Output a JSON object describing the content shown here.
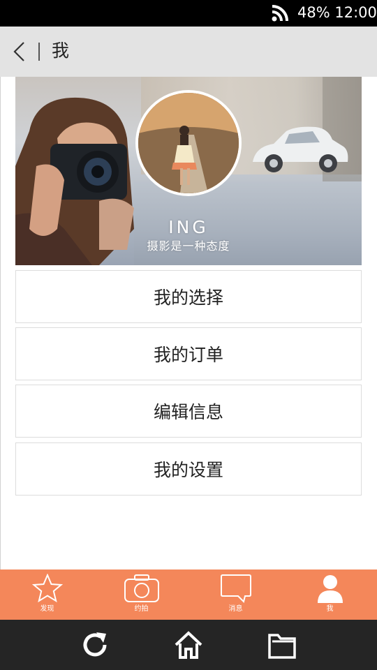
{
  "status_bar": {
    "battery_time": "48% 12:00",
    "icons": [
      "wifi-signal-icon"
    ]
  },
  "nav": {
    "back_icon": "chevron-left-icon",
    "title": "我"
  },
  "profile": {
    "name": "ING",
    "tagline": "摄影是一种态度"
  },
  "menu": [
    {
      "label": "我的选择"
    },
    {
      "label": "我的订单"
    },
    {
      "label": "编辑信息"
    },
    {
      "label": "我的设置"
    }
  ],
  "tabs": [
    {
      "label": "发现",
      "icon": "star-icon"
    },
    {
      "label": "约拍",
      "icon": "camera-icon"
    },
    {
      "label": "消息",
      "icon": "message-icon"
    },
    {
      "label": "我",
      "icon": "person-icon"
    }
  ],
  "system_nav": {
    "icons": [
      "refresh-icon",
      "home-icon",
      "folder-icon"
    ]
  },
  "colors": {
    "tab_bar": "#f4875a",
    "nav_bar": "#e3e3e3",
    "system_bar": "#252525"
  }
}
